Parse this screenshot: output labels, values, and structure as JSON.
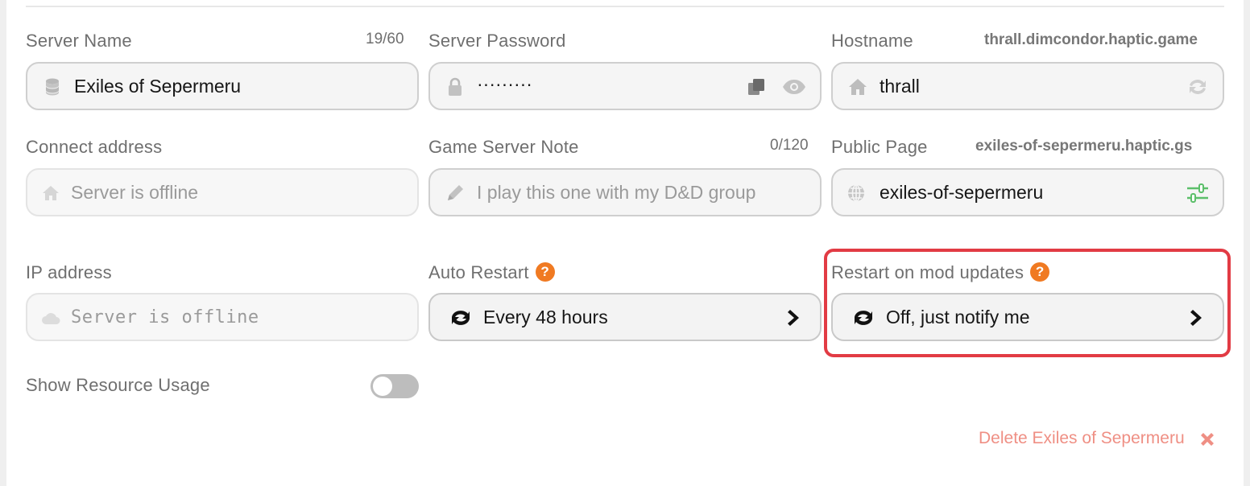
{
  "server_name": {
    "label": "Server Name",
    "counter": "19/60",
    "value": "Exiles of Sepermeru"
  },
  "server_password": {
    "label": "Server Password",
    "value": "·········"
  },
  "hostname": {
    "label": "Hostname",
    "domain": "thrall.dimcondor.haptic.game",
    "value": "thrall"
  },
  "connect_address": {
    "label": "Connect address",
    "placeholder": "Server is offline"
  },
  "game_server_note": {
    "label": "Game Server Note",
    "counter": "0/120",
    "placeholder": "I play this one with my D&D group"
  },
  "public_page": {
    "label": "Public Page",
    "domain": "exiles-of-sepermeru.haptic.gs",
    "value": "exiles-of-sepermeru"
  },
  "ip_address": {
    "label": "IP address",
    "placeholder": "Server is offline"
  },
  "auto_restart": {
    "label": "Auto Restart",
    "help": "?",
    "value": "Every 48 hours"
  },
  "restart_on_mod_updates": {
    "label": "Restart on mod updates",
    "help": "?",
    "value": "Off, just notify me"
  },
  "show_resource_usage": {
    "label": "Show Resource Usage",
    "enabled": false
  },
  "delete": {
    "label": "Delete Exiles of Sepermeru"
  },
  "colors": {
    "accent_help": "#f07a22",
    "highlight": "#e23b44",
    "delete": "#ef8f84",
    "toggle_green": "#5cbf6a"
  }
}
